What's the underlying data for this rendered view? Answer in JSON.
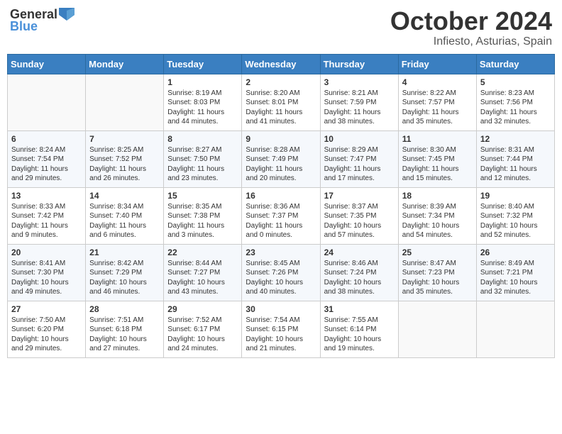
{
  "header": {
    "logo_general": "General",
    "logo_blue": "Blue",
    "month_title": "October 2024",
    "location": "Infiesto, Asturias, Spain"
  },
  "weekdays": [
    "Sunday",
    "Monday",
    "Tuesday",
    "Wednesday",
    "Thursday",
    "Friday",
    "Saturday"
  ],
  "weeks": [
    [
      {
        "day": "",
        "content": ""
      },
      {
        "day": "",
        "content": ""
      },
      {
        "day": "1",
        "content": "Sunrise: 8:19 AM\nSunset: 8:03 PM\nDaylight: 11 hours and 44 minutes."
      },
      {
        "day": "2",
        "content": "Sunrise: 8:20 AM\nSunset: 8:01 PM\nDaylight: 11 hours and 41 minutes."
      },
      {
        "day": "3",
        "content": "Sunrise: 8:21 AM\nSunset: 7:59 PM\nDaylight: 11 hours and 38 minutes."
      },
      {
        "day": "4",
        "content": "Sunrise: 8:22 AM\nSunset: 7:57 PM\nDaylight: 11 hours and 35 minutes."
      },
      {
        "day": "5",
        "content": "Sunrise: 8:23 AM\nSunset: 7:56 PM\nDaylight: 11 hours and 32 minutes."
      }
    ],
    [
      {
        "day": "6",
        "content": "Sunrise: 8:24 AM\nSunset: 7:54 PM\nDaylight: 11 hours and 29 minutes."
      },
      {
        "day": "7",
        "content": "Sunrise: 8:25 AM\nSunset: 7:52 PM\nDaylight: 11 hours and 26 minutes."
      },
      {
        "day": "8",
        "content": "Sunrise: 8:27 AM\nSunset: 7:50 PM\nDaylight: 11 hours and 23 minutes."
      },
      {
        "day": "9",
        "content": "Sunrise: 8:28 AM\nSunset: 7:49 PM\nDaylight: 11 hours and 20 minutes."
      },
      {
        "day": "10",
        "content": "Sunrise: 8:29 AM\nSunset: 7:47 PM\nDaylight: 11 hours and 17 minutes."
      },
      {
        "day": "11",
        "content": "Sunrise: 8:30 AM\nSunset: 7:45 PM\nDaylight: 11 hours and 15 minutes."
      },
      {
        "day": "12",
        "content": "Sunrise: 8:31 AM\nSunset: 7:44 PM\nDaylight: 11 hours and 12 minutes."
      }
    ],
    [
      {
        "day": "13",
        "content": "Sunrise: 8:33 AM\nSunset: 7:42 PM\nDaylight: 11 hours and 9 minutes."
      },
      {
        "day": "14",
        "content": "Sunrise: 8:34 AM\nSunset: 7:40 PM\nDaylight: 11 hours and 6 minutes."
      },
      {
        "day": "15",
        "content": "Sunrise: 8:35 AM\nSunset: 7:38 PM\nDaylight: 11 hours and 3 minutes."
      },
      {
        "day": "16",
        "content": "Sunrise: 8:36 AM\nSunset: 7:37 PM\nDaylight: 11 hours and 0 minutes."
      },
      {
        "day": "17",
        "content": "Sunrise: 8:37 AM\nSunset: 7:35 PM\nDaylight: 10 hours and 57 minutes."
      },
      {
        "day": "18",
        "content": "Sunrise: 8:39 AM\nSunset: 7:34 PM\nDaylight: 10 hours and 54 minutes."
      },
      {
        "day": "19",
        "content": "Sunrise: 8:40 AM\nSunset: 7:32 PM\nDaylight: 10 hours and 52 minutes."
      }
    ],
    [
      {
        "day": "20",
        "content": "Sunrise: 8:41 AM\nSunset: 7:30 PM\nDaylight: 10 hours and 49 minutes."
      },
      {
        "day": "21",
        "content": "Sunrise: 8:42 AM\nSunset: 7:29 PM\nDaylight: 10 hours and 46 minutes."
      },
      {
        "day": "22",
        "content": "Sunrise: 8:44 AM\nSunset: 7:27 PM\nDaylight: 10 hours and 43 minutes."
      },
      {
        "day": "23",
        "content": "Sunrise: 8:45 AM\nSunset: 7:26 PM\nDaylight: 10 hours and 40 minutes."
      },
      {
        "day": "24",
        "content": "Sunrise: 8:46 AM\nSunset: 7:24 PM\nDaylight: 10 hours and 38 minutes."
      },
      {
        "day": "25",
        "content": "Sunrise: 8:47 AM\nSunset: 7:23 PM\nDaylight: 10 hours and 35 minutes."
      },
      {
        "day": "26",
        "content": "Sunrise: 8:49 AM\nSunset: 7:21 PM\nDaylight: 10 hours and 32 minutes."
      }
    ],
    [
      {
        "day": "27",
        "content": "Sunrise: 7:50 AM\nSunset: 6:20 PM\nDaylight: 10 hours and 29 minutes."
      },
      {
        "day": "28",
        "content": "Sunrise: 7:51 AM\nSunset: 6:18 PM\nDaylight: 10 hours and 27 minutes."
      },
      {
        "day": "29",
        "content": "Sunrise: 7:52 AM\nSunset: 6:17 PM\nDaylight: 10 hours and 24 minutes."
      },
      {
        "day": "30",
        "content": "Sunrise: 7:54 AM\nSunset: 6:15 PM\nDaylight: 10 hours and 21 minutes."
      },
      {
        "day": "31",
        "content": "Sunrise: 7:55 AM\nSunset: 6:14 PM\nDaylight: 10 hours and 19 minutes."
      },
      {
        "day": "",
        "content": ""
      },
      {
        "day": "",
        "content": ""
      }
    ]
  ]
}
